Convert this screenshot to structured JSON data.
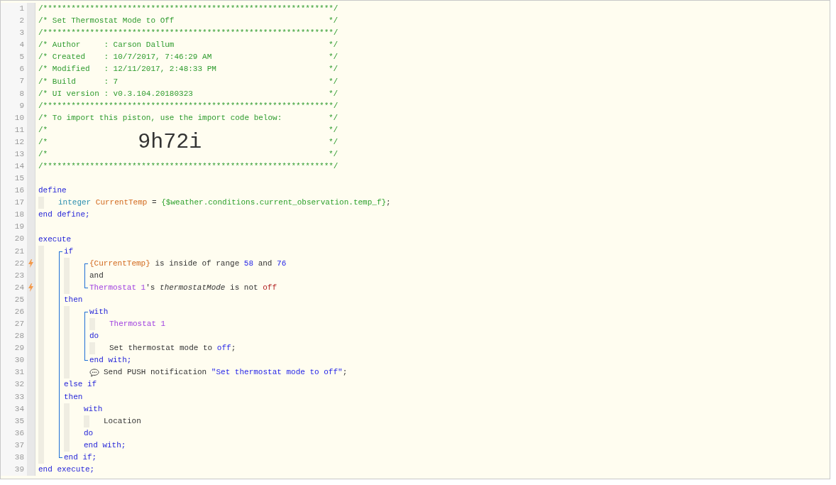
{
  "editor": {
    "lines": [
      {
        "number": "1",
        "trigger": false,
        "tokens": [
          {
            "kind": "comment",
            "text": "/**************************************************************/"
          }
        ]
      },
      {
        "number": "2",
        "trigger": false,
        "tokens": [
          {
            "kind": "comment",
            "text": "/* Set Thermostat Mode to Off"
          },
          {
            "kind": "comment_end",
            "text": "*/"
          }
        ]
      },
      {
        "number": "3",
        "trigger": false,
        "tokens": [
          {
            "kind": "comment",
            "text": "/**************************************************************/"
          }
        ]
      },
      {
        "number": "4",
        "trigger": false,
        "tokens": [
          {
            "kind": "comment",
            "text": "/* Author     : Carson Dallum"
          },
          {
            "kind": "comment_end",
            "text": "*/"
          }
        ]
      },
      {
        "number": "5",
        "trigger": false,
        "tokens": [
          {
            "kind": "comment",
            "text": "/* Created    : 10/7/2017, 7:46:29 AM"
          },
          {
            "kind": "comment_end",
            "text": "*/"
          }
        ]
      },
      {
        "number": "6",
        "trigger": false,
        "tokens": [
          {
            "kind": "comment",
            "text": "/* Modified   : 12/11/2017, 2:48:33 PM"
          },
          {
            "kind": "comment_end",
            "text": "*/"
          }
        ]
      },
      {
        "number": "7",
        "trigger": false,
        "tokens": [
          {
            "kind": "comment",
            "text": "/* Build      : 7"
          },
          {
            "kind": "comment_end",
            "text": "*/"
          }
        ]
      },
      {
        "number": "8",
        "trigger": false,
        "tokens": [
          {
            "kind": "comment",
            "text": "/* UI version : v0.3.104.20180323"
          },
          {
            "kind": "comment_end",
            "text": "*/"
          }
        ]
      },
      {
        "number": "9",
        "trigger": false,
        "tokens": [
          {
            "kind": "comment",
            "text": "/**************************************************************/"
          }
        ]
      },
      {
        "number": "10",
        "trigger": false,
        "tokens": [
          {
            "kind": "comment",
            "text": "/* To import this piston, use the import code below:"
          },
          {
            "kind": "comment_end",
            "text": "*/"
          }
        ]
      },
      {
        "number": "11",
        "trigger": false,
        "tokens": [
          {
            "kind": "comment",
            "text": "/*"
          },
          {
            "kind": "comment_end",
            "text": "*/"
          }
        ]
      },
      {
        "number": "12",
        "trigger": false,
        "tokens": [
          {
            "kind": "comment",
            "text": "/*"
          },
          {
            "kind": "import_code",
            "text": "9h72i"
          },
          {
            "kind": "comment_end",
            "text": "*/"
          }
        ]
      },
      {
        "number": "13",
        "trigger": false,
        "tokens": [
          {
            "kind": "comment",
            "text": "/*"
          },
          {
            "kind": "comment_end",
            "text": "*/"
          }
        ]
      },
      {
        "number": "14",
        "trigger": false,
        "tokens": [
          {
            "kind": "comment",
            "text": "/**************************************************************/"
          }
        ]
      },
      {
        "number": "15",
        "trigger": false
      },
      {
        "number": "16",
        "trigger": false,
        "tokens": [
          {
            "kind": "keyword",
            "text": "define"
          }
        ]
      },
      {
        "number": "17",
        "trigger": false,
        "tokens": [
          {
            "kind": "guide"
          },
          {
            "kind": "type",
            "text": "integer "
          },
          {
            "kind": "variable",
            "text": "CurrentTemp"
          },
          {
            "kind": "plain",
            "text": " = "
          },
          {
            "kind": "expression",
            "text": "{$weather.conditions.current_observation.temp_f}"
          },
          {
            "kind": "plain",
            "text": ";"
          }
        ]
      },
      {
        "number": "18",
        "trigger": false,
        "tokens": [
          {
            "kind": "keyword",
            "text": "end define;"
          }
        ]
      },
      {
        "number": "19",
        "trigger": false
      },
      {
        "number": "20",
        "trigger": false,
        "tokens": [
          {
            "kind": "keyword",
            "text": "execute"
          }
        ]
      },
      {
        "number": "21",
        "trigger": false,
        "tokens": [
          {
            "kind": "guide"
          },
          {
            "kind": "rail_top"
          },
          {
            "kind": "keyword",
            "text": "if"
          }
        ]
      },
      {
        "number": "22",
        "trigger": true,
        "tokens": [
          {
            "kind": "guide"
          },
          {
            "kind": "rail"
          },
          {
            "kind": "guide"
          },
          {
            "kind": "rail_top"
          },
          {
            "kind": "variable",
            "text": "{CurrentTemp}"
          },
          {
            "kind": "plain",
            "text": " is inside of range "
          },
          {
            "kind": "literal",
            "text": "58"
          },
          {
            "kind": "plain",
            "text": " and "
          },
          {
            "kind": "literal",
            "text": "76"
          }
        ]
      },
      {
        "number": "23",
        "trigger": false,
        "tokens": [
          {
            "kind": "guide"
          },
          {
            "kind": "rail"
          },
          {
            "kind": "guide"
          },
          {
            "kind": "rail"
          },
          {
            "kind": "plain",
            "text": "and"
          }
        ]
      },
      {
        "number": "24",
        "trigger": true,
        "tokens": [
          {
            "kind": "guide"
          },
          {
            "kind": "rail"
          },
          {
            "kind": "guide"
          },
          {
            "kind": "rail_end"
          },
          {
            "kind": "device",
            "text": "Thermostat 1"
          },
          {
            "kind": "plain",
            "text": "'s "
          },
          {
            "kind": "attribute",
            "text": "thermostatMode"
          },
          {
            "kind": "plain",
            "text": " is not "
          },
          {
            "kind": "value",
            "text": "off"
          }
        ]
      },
      {
        "number": "25",
        "trigger": false,
        "tokens": [
          {
            "kind": "guide"
          },
          {
            "kind": "rail"
          },
          {
            "kind": "keyword",
            "text": "then"
          }
        ]
      },
      {
        "number": "26",
        "trigger": false,
        "tokens": [
          {
            "kind": "guide"
          },
          {
            "kind": "rail"
          },
          {
            "kind": "guide"
          },
          {
            "kind": "rail_top"
          },
          {
            "kind": "keyword",
            "text": "with"
          }
        ]
      },
      {
        "number": "27",
        "trigger": false,
        "tokens": [
          {
            "kind": "guide"
          },
          {
            "kind": "rail"
          },
          {
            "kind": "guide"
          },
          {
            "kind": "rail"
          },
          {
            "kind": "guide"
          },
          {
            "kind": "device",
            "text": "Thermostat 1"
          }
        ]
      },
      {
        "number": "28",
        "trigger": false,
        "tokens": [
          {
            "kind": "guide"
          },
          {
            "kind": "rail"
          },
          {
            "kind": "guide"
          },
          {
            "kind": "rail"
          },
          {
            "kind": "keyword",
            "text": "do"
          }
        ]
      },
      {
        "number": "29",
        "trigger": false,
        "tokens": [
          {
            "kind": "guide"
          },
          {
            "kind": "rail"
          },
          {
            "kind": "guide"
          },
          {
            "kind": "rail"
          },
          {
            "kind": "guide"
          },
          {
            "kind": "plain",
            "text": "Set thermostat mode to "
          },
          {
            "kind": "literal",
            "text": "off"
          },
          {
            "kind": "plain",
            "text": ";"
          }
        ]
      },
      {
        "number": "30",
        "trigger": false,
        "tokens": [
          {
            "kind": "guide"
          },
          {
            "kind": "rail"
          },
          {
            "kind": "guide"
          },
          {
            "kind": "rail_end"
          },
          {
            "kind": "keyword",
            "text": "end with;"
          }
        ]
      },
      {
        "number": "31",
        "trigger": false,
        "tokens": [
          {
            "kind": "guide"
          },
          {
            "kind": "rail"
          },
          {
            "kind": "guide"
          },
          {
            "kind": "pad"
          },
          {
            "kind": "notify_icon"
          },
          {
            "kind": "plain",
            "text": "Send PUSH notification "
          },
          {
            "kind": "literal",
            "text": "\"Set thermostat mode to off\""
          },
          {
            "kind": "plain",
            "text": ";"
          }
        ]
      },
      {
        "number": "32",
        "trigger": false,
        "tokens": [
          {
            "kind": "guide"
          },
          {
            "kind": "rail"
          },
          {
            "kind": "keyword",
            "text": "else if"
          }
        ]
      },
      {
        "number": "33",
        "trigger": false,
        "tokens": [
          {
            "kind": "guide"
          },
          {
            "kind": "rail"
          },
          {
            "kind": "keyword",
            "text": "then"
          }
        ]
      },
      {
        "number": "34",
        "trigger": false,
        "tokens": [
          {
            "kind": "guide"
          },
          {
            "kind": "rail"
          },
          {
            "kind": "guide"
          },
          {
            "kind": "keyword",
            "text": "with"
          }
        ]
      },
      {
        "number": "35",
        "trigger": false,
        "tokens": [
          {
            "kind": "guide"
          },
          {
            "kind": "rail"
          },
          {
            "kind": "guide"
          },
          {
            "kind": "guide"
          },
          {
            "kind": "plain",
            "text": "Location"
          }
        ]
      },
      {
        "number": "36",
        "trigger": false,
        "tokens": [
          {
            "kind": "guide"
          },
          {
            "kind": "rail"
          },
          {
            "kind": "guide"
          },
          {
            "kind": "keyword",
            "text": "do"
          }
        ]
      },
      {
        "number": "37",
        "trigger": false,
        "tokens": [
          {
            "kind": "guide"
          },
          {
            "kind": "rail"
          },
          {
            "kind": "guide"
          },
          {
            "kind": "keyword",
            "text": "end with;"
          }
        ]
      },
      {
        "number": "38",
        "trigger": false,
        "tokens": [
          {
            "kind": "guide"
          },
          {
            "kind": "rail_end"
          },
          {
            "kind": "keyword",
            "text": "end if;"
          }
        ]
      },
      {
        "number": "39",
        "trigger": false,
        "tokens": [
          {
            "kind": "keyword",
            "text": "end execute;"
          }
        ]
      }
    ]
  }
}
